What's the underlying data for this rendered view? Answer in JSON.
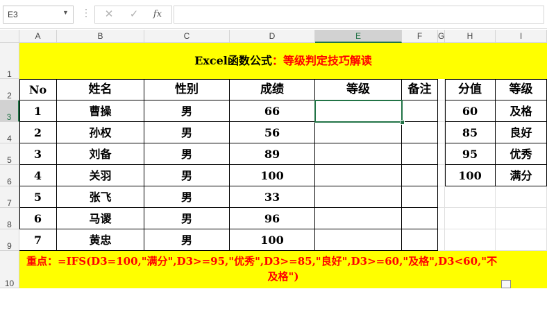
{
  "name_box": "E3",
  "formula_bar": {
    "cancel_icon": "✕",
    "enter_icon": "✓",
    "fx_label": "fx",
    "formula": ""
  },
  "columns": [
    "A",
    "B",
    "C",
    "D",
    "E",
    "F",
    "G",
    "H",
    "I"
  ],
  "rows": [
    "1",
    "2",
    "3",
    "4",
    "5",
    "6",
    "7",
    "8",
    "9",
    "10"
  ],
  "title": {
    "prefix": "Excel函数公式",
    "suffix": "：等级判定技巧解读"
  },
  "table_headers": [
    "No",
    "姓名",
    "性别",
    "成绩",
    "等级",
    "备注"
  ],
  "table_rows": [
    [
      "1",
      "曹操",
      "男",
      "66",
      "",
      ""
    ],
    [
      "2",
      "孙权",
      "男",
      "56",
      "",
      ""
    ],
    [
      "3",
      "刘备",
      "男",
      "89",
      "",
      ""
    ],
    [
      "4",
      "关羽",
      "男",
      "100",
      "",
      ""
    ],
    [
      "5",
      "张飞",
      "男",
      "33",
      "",
      ""
    ],
    [
      "6",
      "马谡",
      "男",
      "96",
      "",
      ""
    ],
    [
      "7",
      "黄忠",
      "男",
      "100",
      "",
      ""
    ]
  ],
  "lookup_headers": [
    "分值",
    "等级"
  ],
  "lookup_rows": [
    [
      "60",
      "及格"
    ],
    [
      "85",
      "良好"
    ],
    [
      "95",
      "优秀"
    ],
    [
      "100",
      "满分"
    ]
  ],
  "note": {
    "label": "重点：",
    "line1": "=IFS(D3=100,\"满分\",D3>=95,\"优秀\",D3>=85,\"良好\",D3>=60,\"及格\",D3<60,\"不",
    "line2": "及格\")"
  },
  "colors": {
    "highlight": "#ffff00",
    "accent_red": "#ff0000",
    "selection": "#217346"
  }
}
